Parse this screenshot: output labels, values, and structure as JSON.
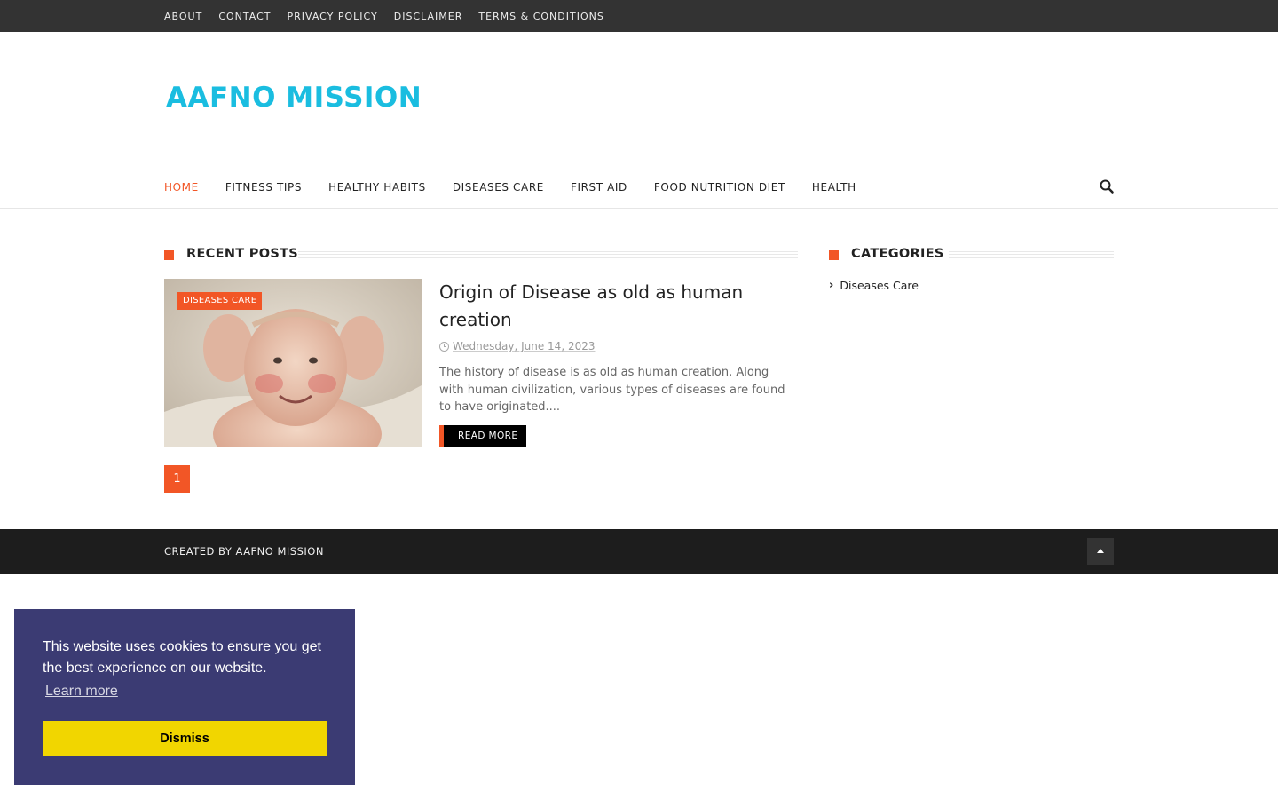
{
  "topbar": {
    "links": [
      "About",
      "Contact",
      "Privacy Policy",
      "Disclaimer",
      "Terms & Conditions"
    ]
  },
  "site": {
    "title": "AAFNO MISSION"
  },
  "nav": {
    "items": [
      "Home",
      "Fitness Tips",
      "Healthy Habits",
      "Diseases Care",
      "First Aid",
      "Food Nutrition Diet",
      "Health"
    ],
    "active": "Home"
  },
  "recent": {
    "heading": "Recent Posts",
    "post": {
      "category": "Diseases Care",
      "title": "Origin of Disease as old as human creation",
      "date": "Wednesday, June 14, 2023",
      "excerpt": "The history of  disease  is as old as human creation. Along with human civilization, various types of diseases are found to have originated....",
      "read_more": "Read More"
    },
    "page": "1"
  },
  "sidebar": {
    "heading": "Categories",
    "items": [
      "Diseases Care"
    ]
  },
  "footer": {
    "credit": "Created By AAFNO MISSION"
  },
  "cookie": {
    "message": "This website uses cookies to ensure you get the best experience on our website.",
    "learn_more": "Learn more",
    "dismiss": "Dismiss"
  },
  "colors": {
    "accent": "#f25626",
    "logo": "#1abde0",
    "topbar": "#333333",
    "cookie_bg": "#3b3b73",
    "cookie_button": "#f1d600"
  }
}
